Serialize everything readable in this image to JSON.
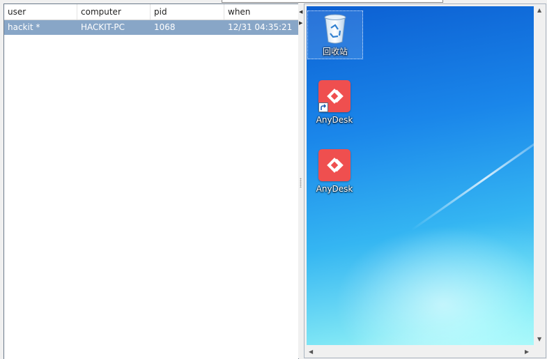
{
  "sessions_table": {
    "columns": [
      "user",
      "computer",
      "pid",
      "when"
    ],
    "rows": [
      {
        "user": "hackit *",
        "computer": "HACKIT-PC",
        "pid": "1068",
        "when": "12/31 04:35:21",
        "selected": true
      }
    ]
  },
  "remote_desktop": {
    "icons": [
      {
        "label": "回收站",
        "icon": "recycle-bin-icon",
        "selected": true
      },
      {
        "label": "AnyDesk",
        "icon": "anydesk-icon",
        "shortcut": true
      },
      {
        "label": "AnyDesk",
        "icon": "anydesk-icon",
        "shortcut": false
      }
    ]
  },
  "colors": {
    "selected_row": "#88a6c7",
    "anydesk_brand": "#ef4f4f"
  }
}
